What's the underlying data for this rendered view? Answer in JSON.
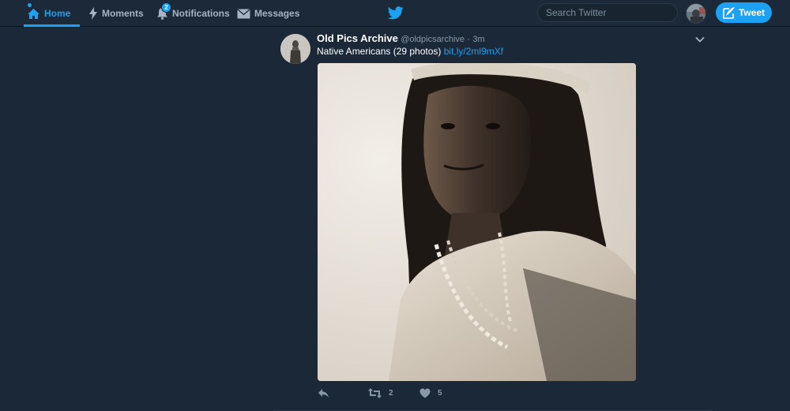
{
  "nav": {
    "home": "Home",
    "moments": "Moments",
    "notifications": "Notifications",
    "notifications_count": "2",
    "messages": "Messages"
  },
  "search": {
    "placeholder": "Search Twitter"
  },
  "tweet_button": "Tweet",
  "tweet": {
    "author_name": "Old Pics Archive",
    "author_handle": "@oldpicsarchive",
    "separator": "·",
    "timestamp": "3m",
    "text": "Native Americans (29 photos)",
    "link": "bit.ly/2ml9mXf",
    "retweet_count": "2",
    "like_count": "5"
  },
  "icons": {
    "home": "home-icon",
    "moments": "lightning-icon",
    "notifications": "bell-icon",
    "messages": "envelope-icon",
    "logo": "twitter-bird-icon",
    "search": "search-icon",
    "compose": "quill-icon",
    "more": "chevron-down-icon",
    "reply": "reply-icon",
    "retweet": "retweet-icon",
    "like": "heart-icon"
  },
  "colors": {
    "background": "#1b2838",
    "nav_bar": "#1c2938",
    "accent": "#1da1f2",
    "muted_text": "#8899a6"
  }
}
